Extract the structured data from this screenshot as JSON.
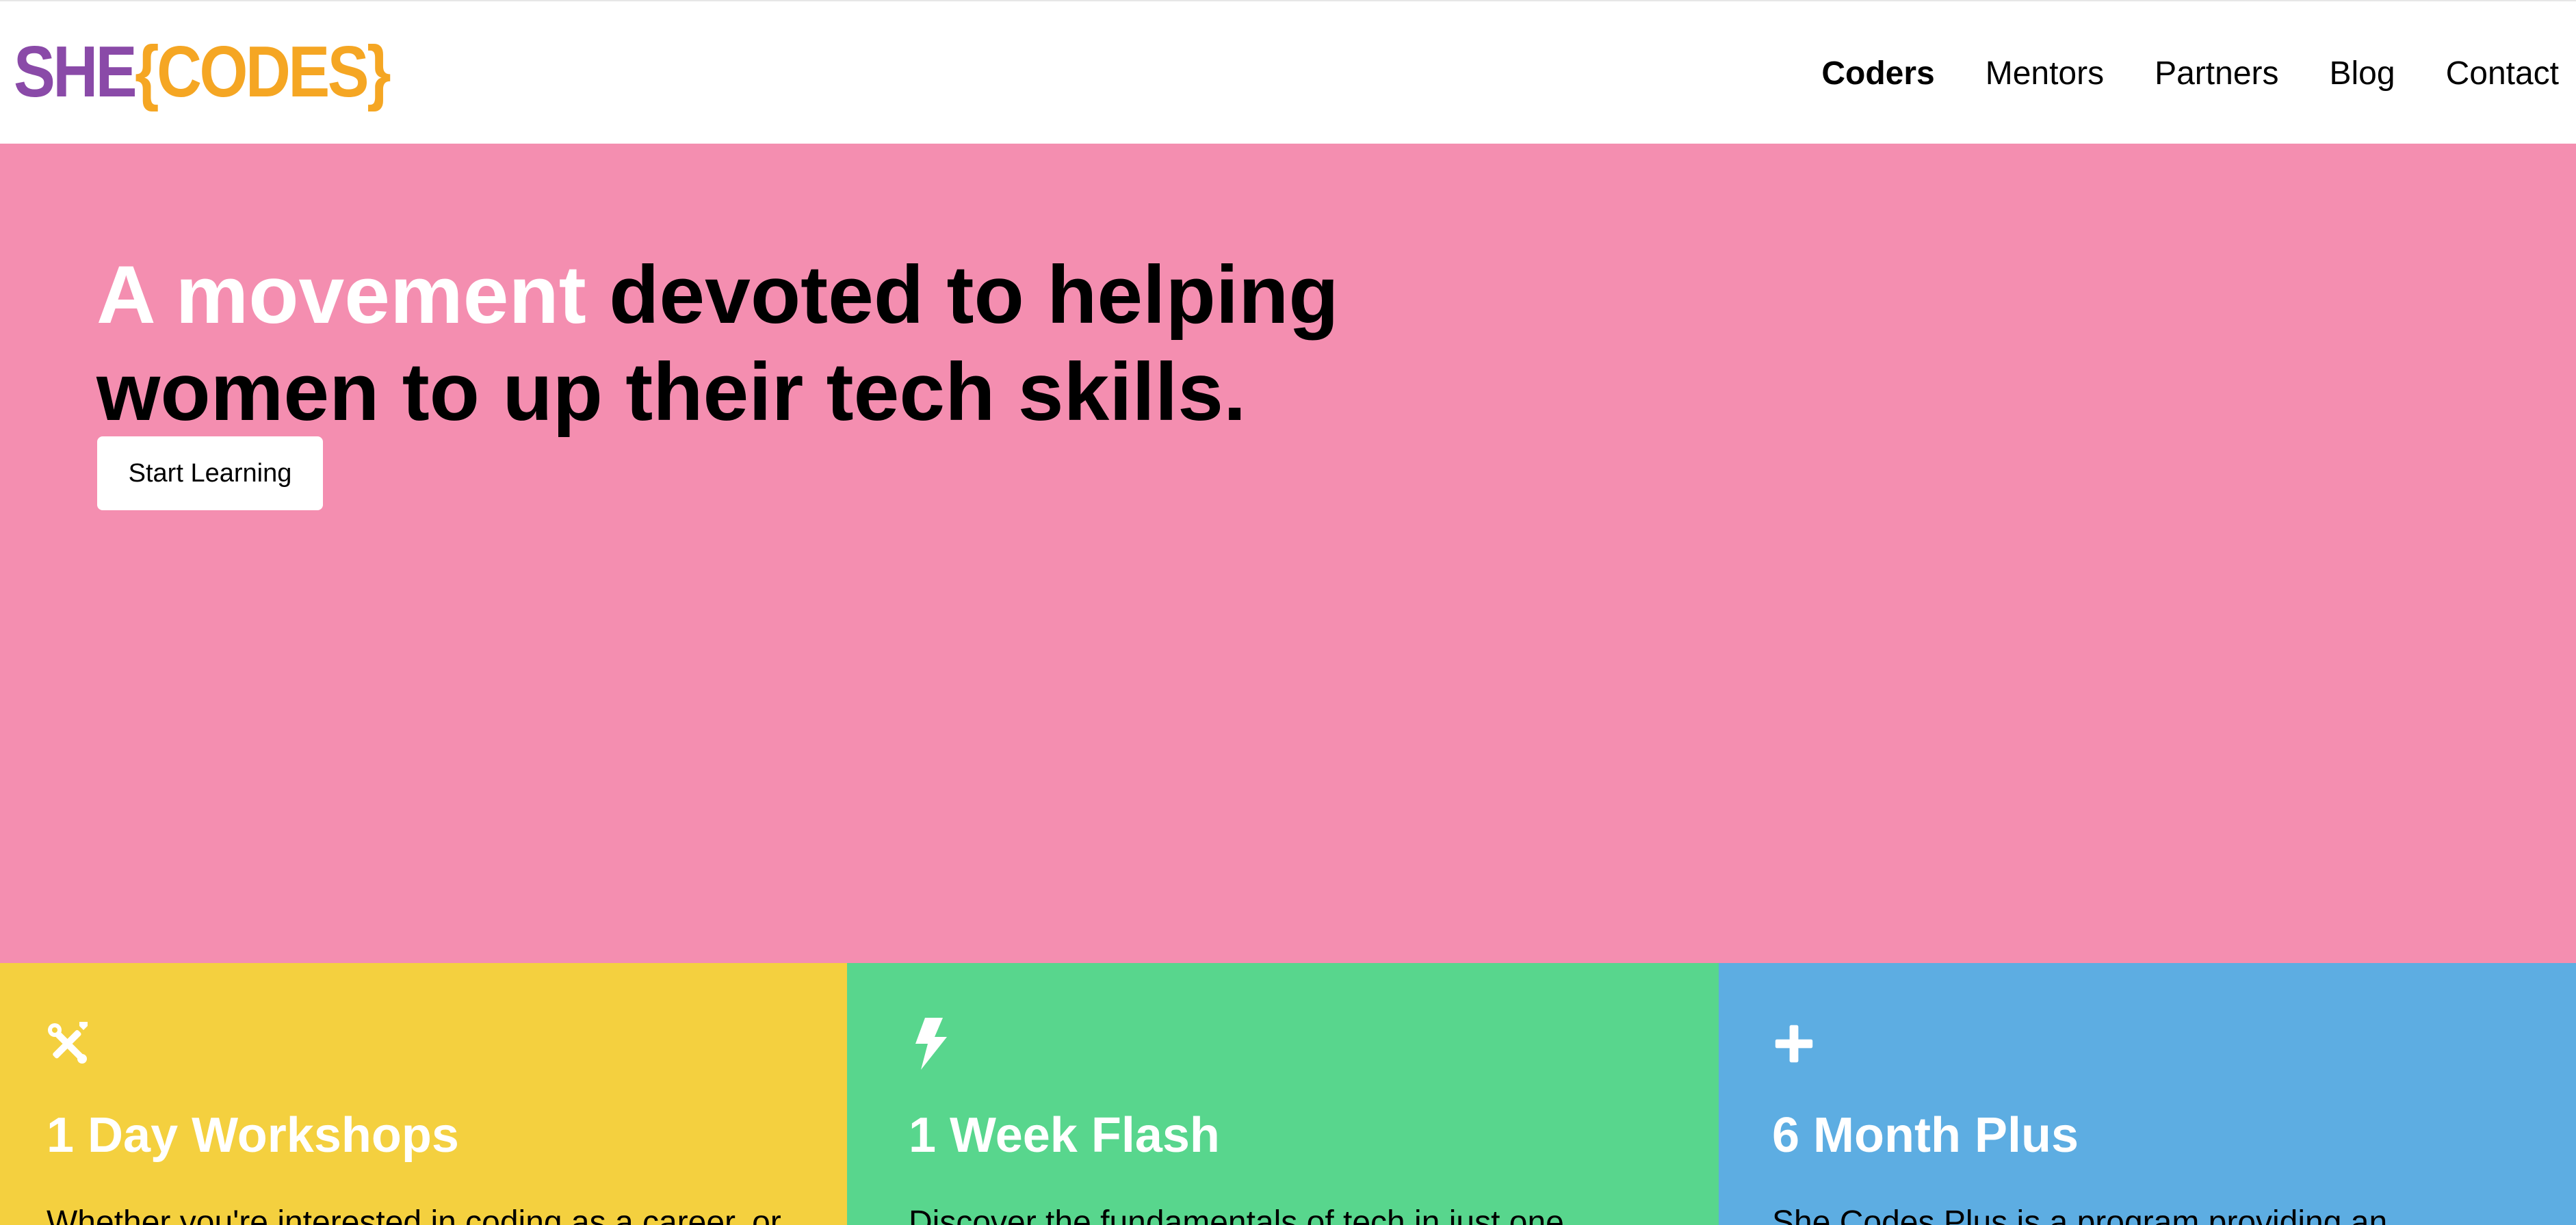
{
  "nav": {
    "logo_she": "SHE",
    "logo_codes": "{CODES}",
    "items": [
      {
        "label": "Coders",
        "active": true
      },
      {
        "label": "Mentors"
      },
      {
        "label": "Partners"
      },
      {
        "label": "Blog"
      },
      {
        "label": "Contact"
      }
    ]
  },
  "hero": {
    "highlight": "A movement",
    "rest": " devoted to helping women to up their tech skills.",
    "cta": "Start Learning",
    "bg_color": "#f48eb0"
  },
  "cards": [
    {
      "icon": "tools-icon",
      "title": "1 Day Workshops",
      "text": "Whether you're interested in coding as a career, or",
      "color": "#f4d03f"
    },
    {
      "icon": "lightning-icon",
      "title": "1 Week Flash",
      "text": "Discover the fundamentals of tech in just one",
      "color": "#58d68d"
    },
    {
      "icon": "plus-icon",
      "title": "6 Month Plus",
      "text": "She Codes Plus is a program providing an",
      "color": "#5dade2"
    }
  ]
}
